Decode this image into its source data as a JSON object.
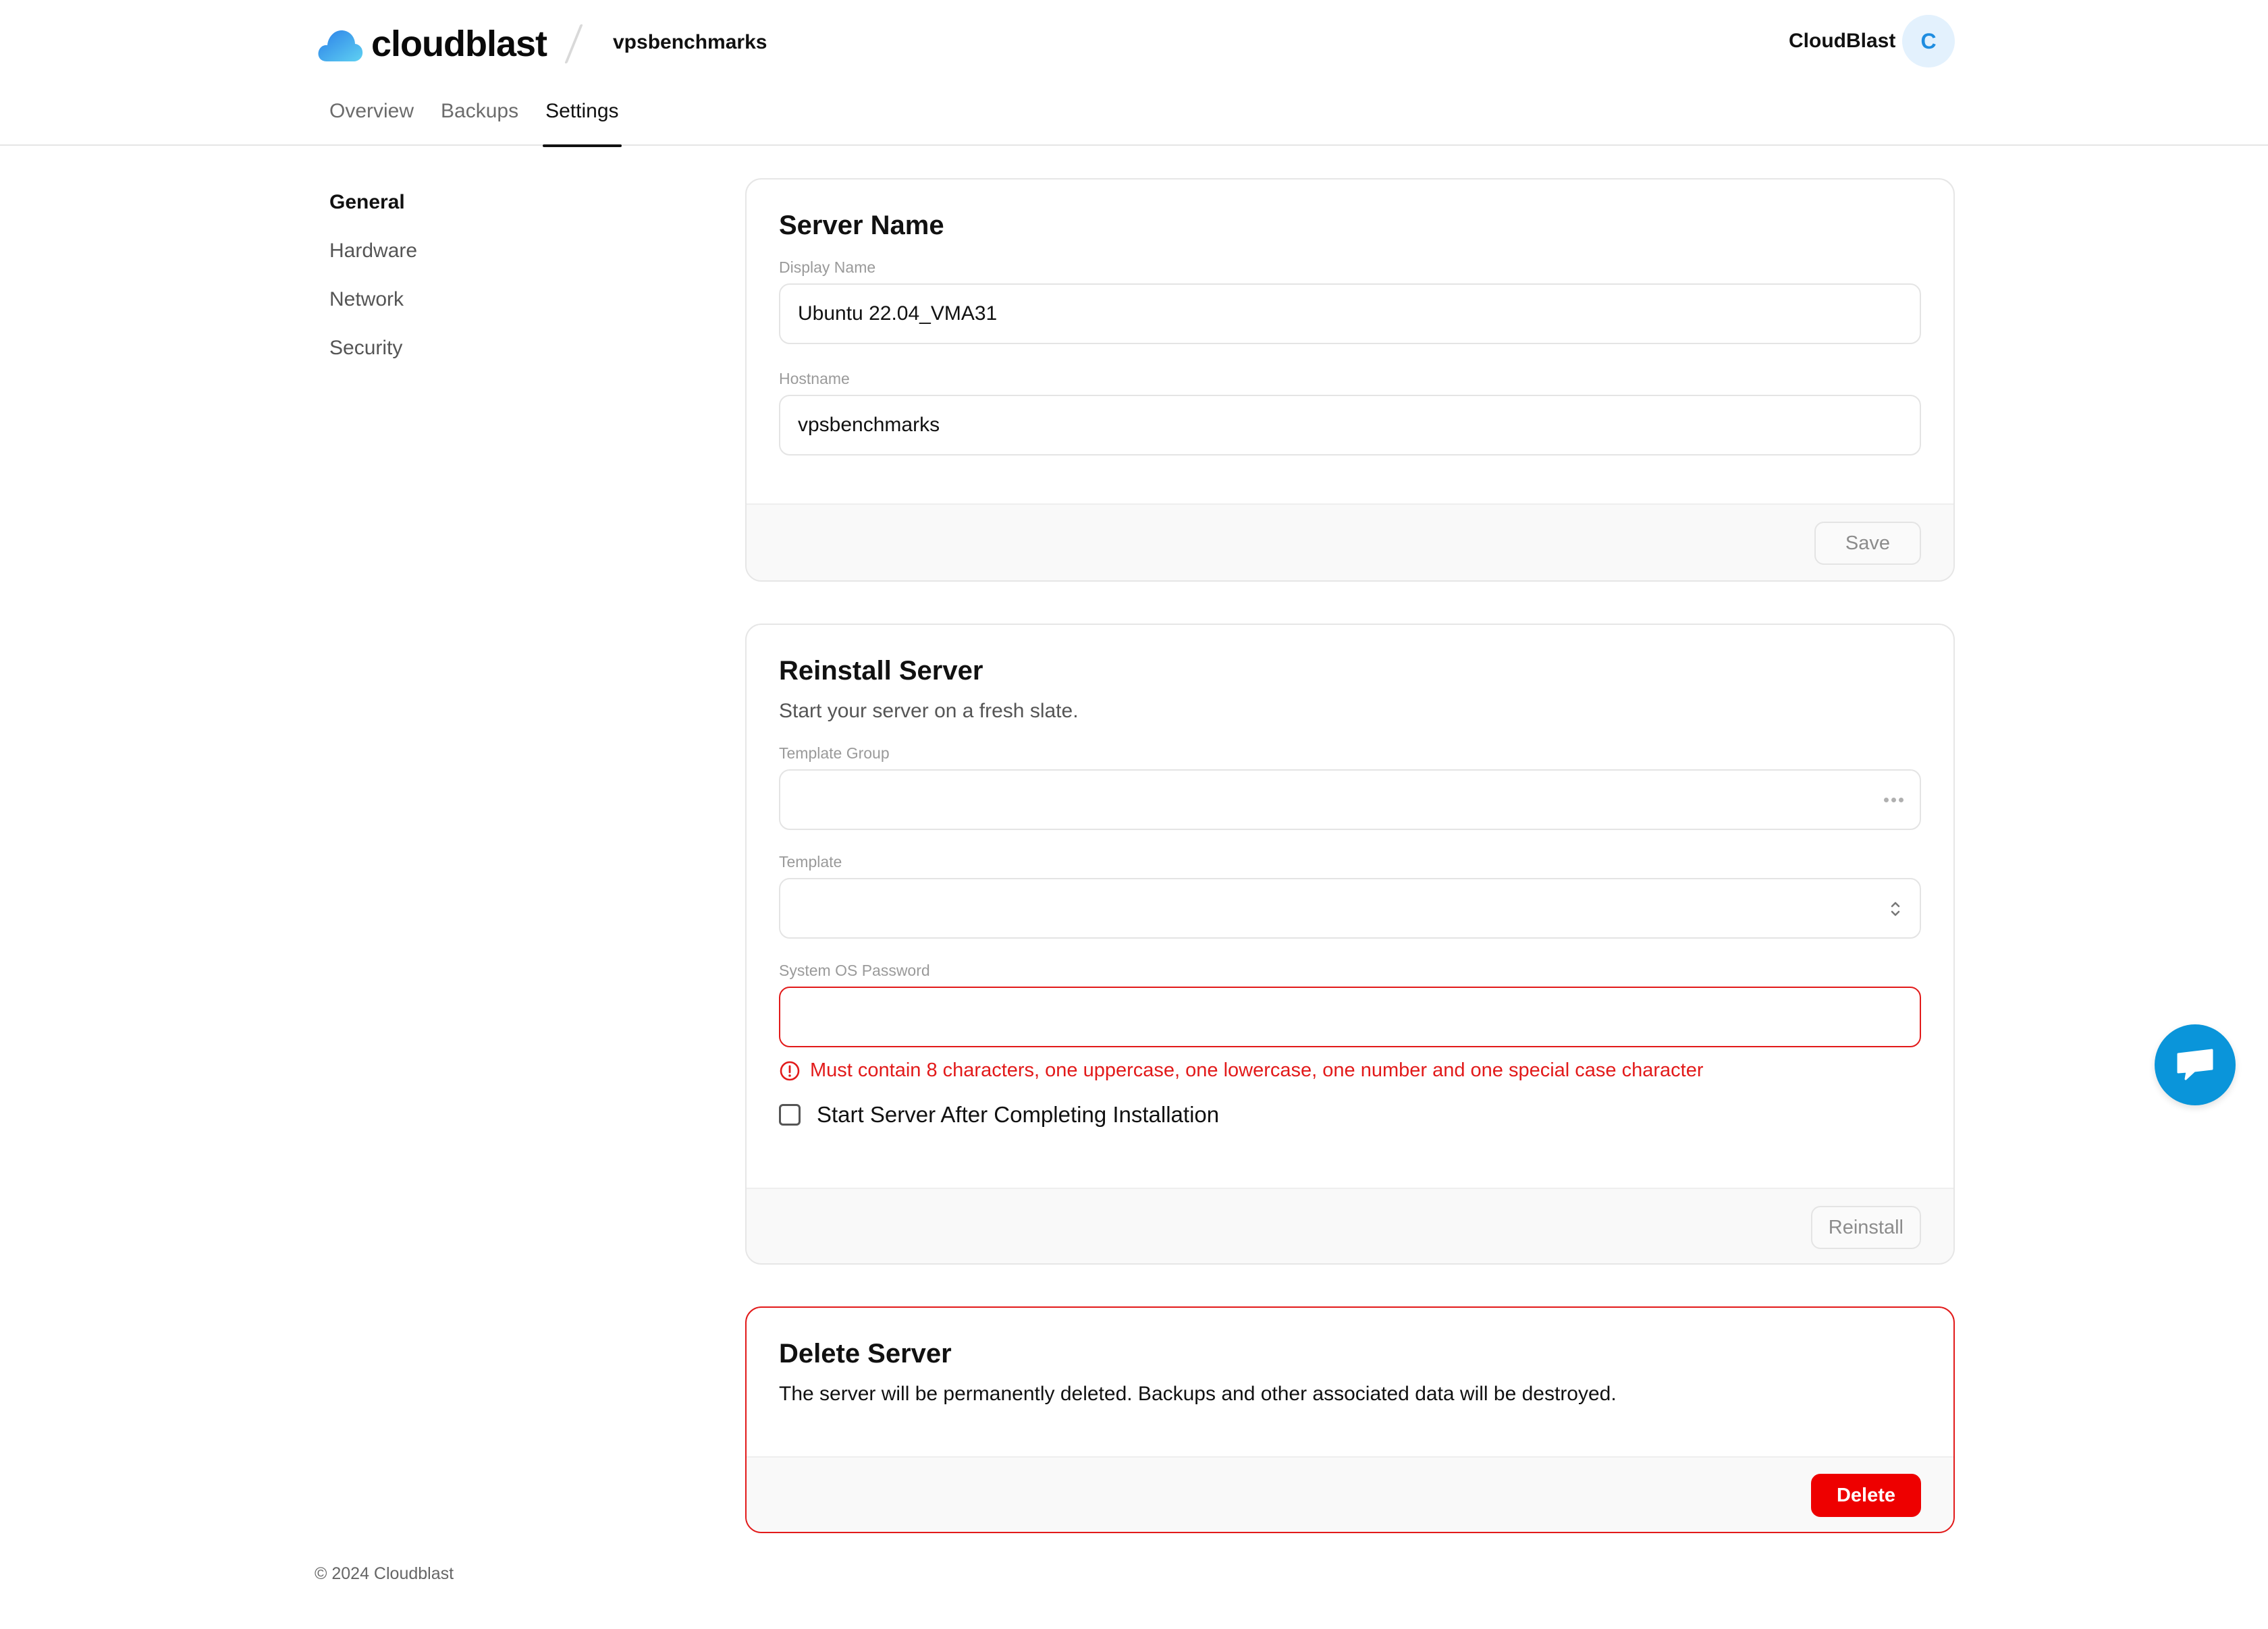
{
  "header": {
    "brand": "cloudblast",
    "server_name": "vpsbenchmarks",
    "user_name": "CloudBlast",
    "avatar_initial": "C",
    "tabs": [
      {
        "label": "Overview",
        "active": false
      },
      {
        "label": "Backups",
        "active": false
      },
      {
        "label": "Settings",
        "active": true
      }
    ]
  },
  "sidenav": {
    "items": [
      {
        "label": "General",
        "active": true
      },
      {
        "label": "Hardware",
        "active": false
      },
      {
        "label": "Network",
        "active": false
      },
      {
        "label": "Security",
        "active": false
      }
    ]
  },
  "server_name_card": {
    "title": "Server Name",
    "display_name_label": "Display Name",
    "display_name_value": "Ubuntu 22.04_VMA31",
    "hostname_label": "Hostname",
    "hostname_value": "vpsbenchmarks",
    "save_label": "Save"
  },
  "reinstall_card": {
    "title": "Reinstall Server",
    "description": "Start your server on a fresh slate.",
    "template_group_label": "Template Group",
    "template_group_value": "",
    "template_label": "Template",
    "template_value": "",
    "password_label": "System OS Password",
    "password_value": "",
    "password_error": "Must contain 8 characters, one uppercase, one lowercase, one number and one special case character",
    "start_after_label": "Start Server After Completing Installation",
    "start_after_checked": false,
    "reinstall_label": "Reinstall"
  },
  "delete_card": {
    "title": "Delete Server",
    "description": "The server will be permanently deleted. Backups and other associated data will be destroyed.",
    "delete_label": "Delete"
  },
  "footer": {
    "copyright": "© 2024 Cloudblast"
  },
  "colors": {
    "accent": "#1f8de0",
    "danger": "#e21a1a",
    "delete_button": "#ee0000",
    "chat_button": "#0a95da"
  },
  "icons": {
    "logo": "cloud-logo-icon",
    "template_group_loading": "loading-dots-icon",
    "template_select": "chevron-up-down-icon",
    "error": "alert-circle-icon",
    "chat": "chat-bubble-icon"
  }
}
